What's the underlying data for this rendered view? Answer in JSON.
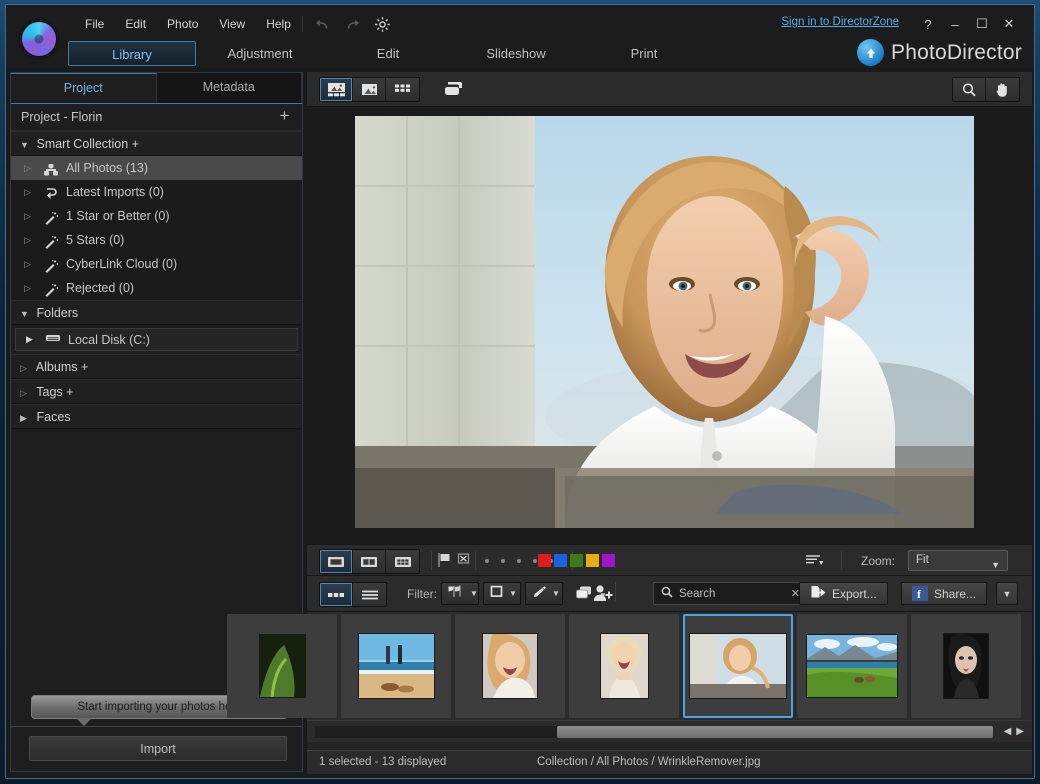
{
  "window": {
    "signin_label": "Sign in to DirectorZone",
    "help_glyph": "?",
    "minimize_glyph": "–",
    "maximize_glyph": "☐",
    "close_glyph": "✕",
    "brand_name": "PhotoDirector"
  },
  "menu": {
    "items": [
      {
        "label": "File"
      },
      {
        "label": "Edit"
      },
      {
        "label": "Photo"
      },
      {
        "label": "View"
      },
      {
        "label": "Help"
      }
    ],
    "icons": [
      "undo-icon",
      "redo-icon",
      "settings-gear-icon"
    ]
  },
  "modes": [
    {
      "label": "Library",
      "active": true
    },
    {
      "label": "Adjustment",
      "active": false
    },
    {
      "label": "Edit",
      "active": false
    },
    {
      "label": "Slideshow",
      "active": false
    },
    {
      "label": "Print",
      "active": false
    }
  ],
  "left_panel": {
    "tabs": [
      {
        "label": "Project",
        "active": true
      },
      {
        "label": "Metadata",
        "active": false
      }
    ],
    "project_header": "Project - Florin",
    "plus_glyph": "+",
    "smart_collection": {
      "label": "Smart Collection",
      "items": [
        {
          "label": "All Photos (13)",
          "icon": "photos-icon",
          "selected": true
        },
        {
          "label": "Latest Imports (0)",
          "icon": "import-arrow-icon",
          "selected": false
        },
        {
          "label": "1 Star or Better (0)",
          "icon": "magic-wand-icon",
          "selected": false
        },
        {
          "label": "5 Stars (0)",
          "icon": "magic-wand-icon",
          "selected": false
        },
        {
          "label": "CyberLink Cloud (0)",
          "icon": "magic-wand-icon",
          "selected": false
        },
        {
          "label": "Rejected (0)",
          "icon": "magic-wand-icon",
          "selected": false
        }
      ]
    },
    "folders": {
      "label": "Folders",
      "items": [
        {
          "label": "Local Disk (C:)",
          "icon": "hard-drive-icon"
        }
      ]
    },
    "albums": {
      "label": "Albums"
    },
    "tags": {
      "label": "Tags"
    },
    "faces": {
      "label": "Faces"
    },
    "tooltip": "Start importing your photos here",
    "import_button": "Import"
  },
  "viewer_toolbar": {
    "view_buttons": [
      {
        "name": "viewer-mode-photo-filmstrip",
        "active": true
      },
      {
        "name": "viewer-mode-single-photo",
        "active": false
      },
      {
        "name": "viewer-mode-grid",
        "active": false
      }
    ],
    "compare_button": "compare-icon",
    "zoom_tool": "magnifier-icon",
    "pan_tool": "hand-icon"
  },
  "strip_toolbar": {
    "layout_buttons": [
      {
        "name": "layout-single",
        "active": true
      },
      {
        "name": "layout-side-by-side",
        "active": false
      },
      {
        "name": "layout-grid",
        "active": false
      }
    ],
    "flag_buttons": [
      "flag-pick-icon",
      "flag-reject-icon"
    ],
    "rating_dots": 5,
    "color_labels": [
      "#e01b1b",
      "#1864e0",
      "#3d7a1b",
      "#e8ad12",
      "#9d17cf"
    ],
    "sort_icon": "sort-menu-icon",
    "zoom_label": "Zoom:",
    "zoom_value": "Fit",
    "caret_glyph": "▼"
  },
  "filter_toolbar": {
    "view_buttons": [
      {
        "name": "filmstrip-thumbs-view",
        "active": true
      },
      {
        "name": "filmstrip-list-view",
        "active": false
      }
    ],
    "filter_label": "Filter:",
    "filter_dropdowns": [
      "flags-filter-icon",
      "rating-filter-icon",
      "color-filter-icon"
    ],
    "copies_dropdown": "copies-stack-icon",
    "add_person_button": "add-person-icon",
    "search_placeholder": "Search",
    "search_value": "",
    "search_clear_glyph": "✕",
    "export_label": "Export...",
    "share_label": "Share...",
    "share_caret": "▼"
  },
  "filmstrip": {
    "items": [
      {
        "name": "thumb-forest",
        "selected": false
      },
      {
        "name": "thumb-beach-couple",
        "selected": false
      },
      {
        "name": "thumb-woman-smiling",
        "selected": false
      },
      {
        "name": "thumb-blonde-laughing",
        "selected": false
      },
      {
        "name": "thumb-wrinkle-remover",
        "selected": true
      },
      {
        "name": "thumb-mountain-lake",
        "selected": false
      },
      {
        "name": "thumb-dark-portrait",
        "selected": false
      }
    ],
    "scroll_left_glyph": "◀",
    "scroll_right_glyph": "▶"
  },
  "status_bar": {
    "selection": "1 selected - 13 displayed",
    "path": "Collection / All Photos / WrinkleRemover.jpg"
  },
  "colors": {
    "accent": "#49a5e8",
    "panel": "#2b2b2b",
    "dark": "#1b1b1b",
    "link": "#55aaee"
  }
}
